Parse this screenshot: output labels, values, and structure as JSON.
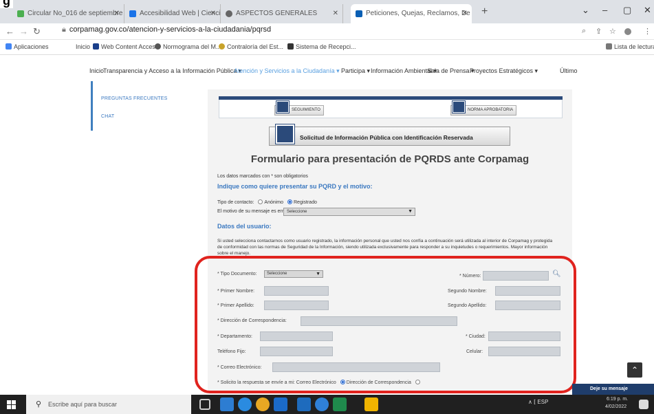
{
  "page_heading_fragment": "g",
  "browser": {
    "tabs": [
      {
        "label": "Circular No_016 de septiembre",
        "color": "#4caf50"
      },
      {
        "label": "Accesibilidad Web | Ciencia de",
        "color": "#1a73e8"
      },
      {
        "label": "ASPECTOS GENERALES",
        "color": "#666666"
      },
      {
        "label": "Peticiones, Quejas, Reclamos, De",
        "color": "#0a5fb4"
      }
    ],
    "url": "corpamag.gov.co/atencion-y-servicios-a-la-ciudadania/pqrsd",
    "bookmarks": [
      "Aplicaciones",
      "Inicio",
      "Web Content Acces...",
      "Normograma del M...",
      "Contraloría del Est...",
      "Sistema de Recepci...",
      "Lista de lectura"
    ],
    "window_controls": [
      "⌄",
      "–",
      "▢",
      "✕"
    ]
  },
  "site_nav": [
    "Inicio",
    "Transparencia y Acceso a la Información Pública ▾",
    "Atención y Servicios a la Ciudadanía ▾",
    "Participa ▾",
    "Información Ambiental ▾",
    "Sala de Prensa ▾",
    "Proyectos Estratégicos ▾",
    "Último"
  ],
  "sidebar": [
    "PREGUNTAS FRECUENTES",
    "CHAT"
  ],
  "buttons": {
    "seguimiento": "SEGUIMIENTO",
    "norma": "NORMA APROBATORIA",
    "reserved": "Solicitud de Información Pública con Identificación Reservada"
  },
  "form": {
    "title": "Formulario para presentación de PQRDS ante Corpamag",
    "required_note": "Los datos marcados con * son obligatorios",
    "section1": "Indique como quiere presentar su PQRD y el motivo:",
    "contact_label": "Tipo de contacto:",
    "contact_options": [
      "Anónimo",
      "Registrado"
    ],
    "contact_selected": "Registrado",
    "motivo_label": "El motivo de su mensaje es enviar una:",
    "motivo_value": "Seleccione",
    "section2": "Datos del usuario:",
    "info_text": "Si usted selecciona contactarnos como usuario registrado, la información personal que usted nos confía a continuación será utilizada al interior de Corpamag y protegida de conformidad con las normas de Seguridad de la Información, siendo utilizada exclusivamente para responder a su inquietudes o requerimientos. Mayor información sobre el manejo.",
    "tipo_doc_label": "* Tipo Documento:",
    "tipo_doc_value": "Seleccione",
    "numero_label": "* Número:",
    "primer_nombre_label": "* Primer Nombre:",
    "segundo_nombre_label": "Segundo Nombre:",
    "primer_apellido_label": "* Primer Apellido:",
    "segundo_apellido_label": "Segundo Apellido:",
    "direccion_label": "* Dirección de Correspondencia:",
    "departamento_label": "* Departamento:",
    "ciudad_label": "* Ciudad:",
    "telefono_label": "Teléfono Fijo:",
    "celular_label": "Celular:",
    "correo_label": "* Correo Electrónico:",
    "respuesta_label": "* Solicito la respuesta se envíe a mi: Correo Electrónico",
    "respuesta_alt": "Dirección de Correspondencia"
  },
  "chat_widget": "Deje su mensaje",
  "taskbar": {
    "search_placeholder": "Escribe aquí para buscar",
    "tray_text": "∧ ⁅ ESP",
    "time": "6:19 p. m.",
    "date": "4/02/2022"
  },
  "colors": {
    "accent": "#3a78c0",
    "highlight": "#e0231e",
    "navy": "#2b4a7a"
  }
}
